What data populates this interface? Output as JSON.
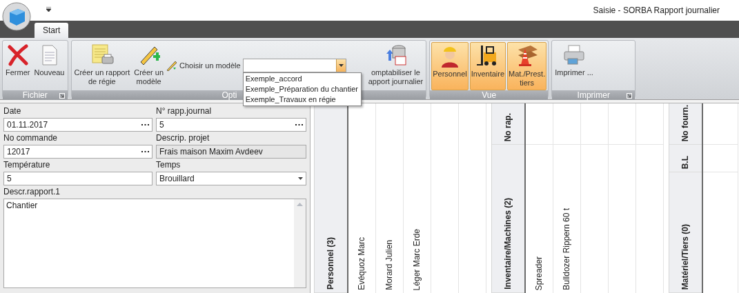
{
  "window": {
    "title": "Saisie - SORBA Rapport journalier"
  },
  "tabs": [
    {
      "label": "Start",
      "selected": true
    }
  ],
  "ribbon": {
    "groups": [
      {
        "label": "Fichier",
        "launcher": true,
        "items": [
          {
            "kind": "button",
            "label": "Fermer"
          },
          {
            "kind": "button",
            "label": "Nouveau"
          }
        ]
      },
      {
        "label": "Opti",
        "launcher": false,
        "items": [
          {
            "kind": "button",
            "label": "Créer un rapport\nde régie"
          },
          {
            "kind": "button",
            "label": "Créer un\nmodèle"
          },
          {
            "kind": "combo",
            "label": "Choisir un modèle",
            "open": true,
            "options": [
              "Exemple_accord",
              "Exemple_Préparation du chantier",
              "Exemple_Travaux en régie"
            ]
          },
          {
            "kind": "button",
            "label": "omptabiliser le\napport journalier"
          }
        ]
      },
      {
        "label": "Vue",
        "launcher": false,
        "items": [
          {
            "kind": "toggle",
            "label": "Personnel",
            "selected": true
          },
          {
            "kind": "toggle",
            "label": "Inventaire",
            "selected": true
          },
          {
            "kind": "toggle",
            "label": "Mat./Prest.\ntiers",
            "selected": true
          }
        ]
      },
      {
        "label": "Imprimer",
        "launcher": true,
        "items": [
          {
            "kind": "button",
            "label": "Imprimer ..."
          }
        ]
      }
    ]
  },
  "form": {
    "fields": [
      {
        "label": "Date",
        "value": "01.11.2017",
        "kind": "ellipsis"
      },
      {
        "label": "N° rapp.journal",
        "value": "5",
        "kind": "ellipsis"
      },
      {
        "label": "No commande",
        "value": "12017",
        "kind": "ellipsis"
      },
      {
        "label": "Descrip. projet",
        "value": "Frais maison Maxim Avdeev",
        "kind": "readonly"
      },
      {
        "label": "Température",
        "value": "5",
        "kind": "text"
      },
      {
        "label": "Temps",
        "value": "Brouillard",
        "kind": "select"
      }
    ],
    "description": {
      "label": "Descr.rapport.1",
      "value": "Chantier"
    }
  },
  "grid": {
    "sections": [
      {
        "headers": [
          "Personnel (3)"
        ],
        "columns": [
          "Evéquoz Marc",
          "Morard Julien",
          "Léger Marc Erde"
        ]
      },
      {
        "headers": [
          "No rap.",
          "Inventaire/Machines (2)"
        ],
        "columns": [
          "Spreader",
          "Bulldozer Rippern 60 t"
        ]
      },
      {
        "headers": [
          "No fourn.",
          "B.L",
          "Matériel/Tiers (0)"
        ]
      }
    ]
  }
}
